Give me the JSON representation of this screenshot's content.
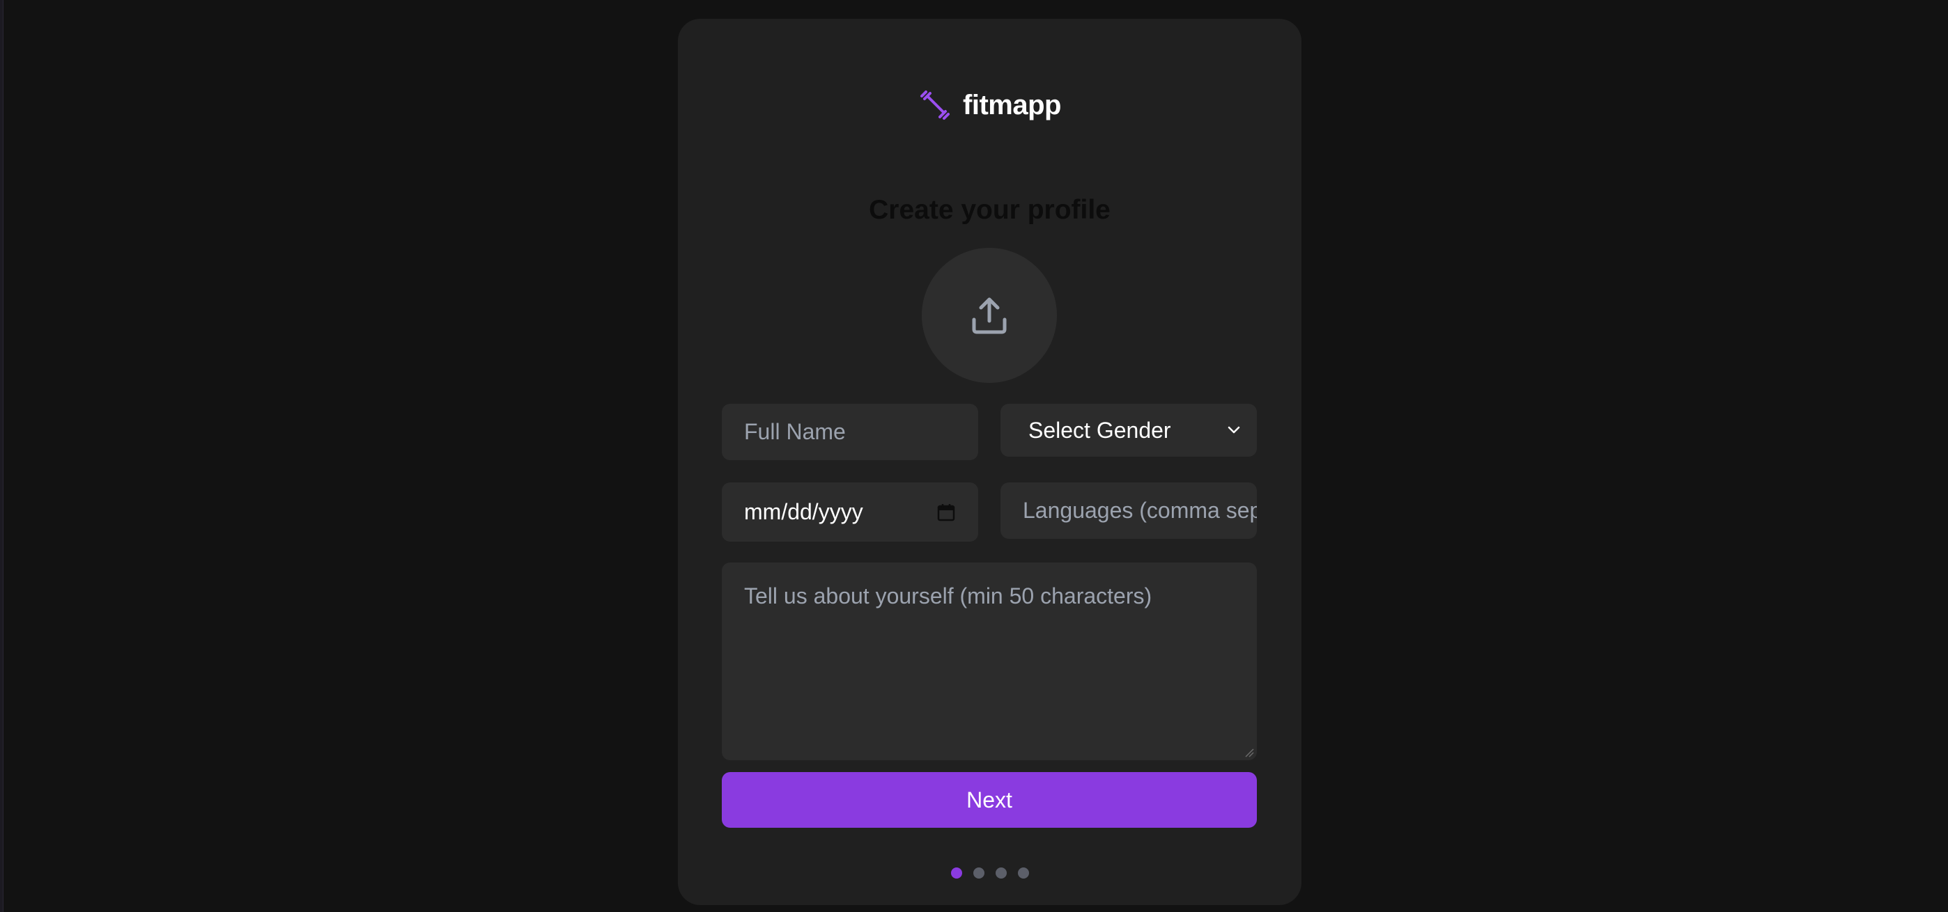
{
  "brand": {
    "name": "fitmapp",
    "icon": "dumbbell-icon",
    "accent_color": "#8a3be0"
  },
  "page": {
    "title": "Create your profile"
  },
  "upload": {
    "icon": "upload-icon"
  },
  "form": {
    "full_name": {
      "placeholder": "Full Name",
      "value": ""
    },
    "gender": {
      "selected": "Select Gender",
      "icon": "chevron-down-icon"
    },
    "birthdate": {
      "value": "mm/dd/yyyy",
      "icon": "calendar-icon"
    },
    "languages": {
      "placeholder": "Languages (comma separated)",
      "value": ""
    },
    "bio": {
      "placeholder": "Tell us about yourself (min 50 characters)",
      "value": ""
    }
  },
  "actions": {
    "next_label": "Next"
  },
  "steps": {
    "total": 4,
    "current": 1
  }
}
